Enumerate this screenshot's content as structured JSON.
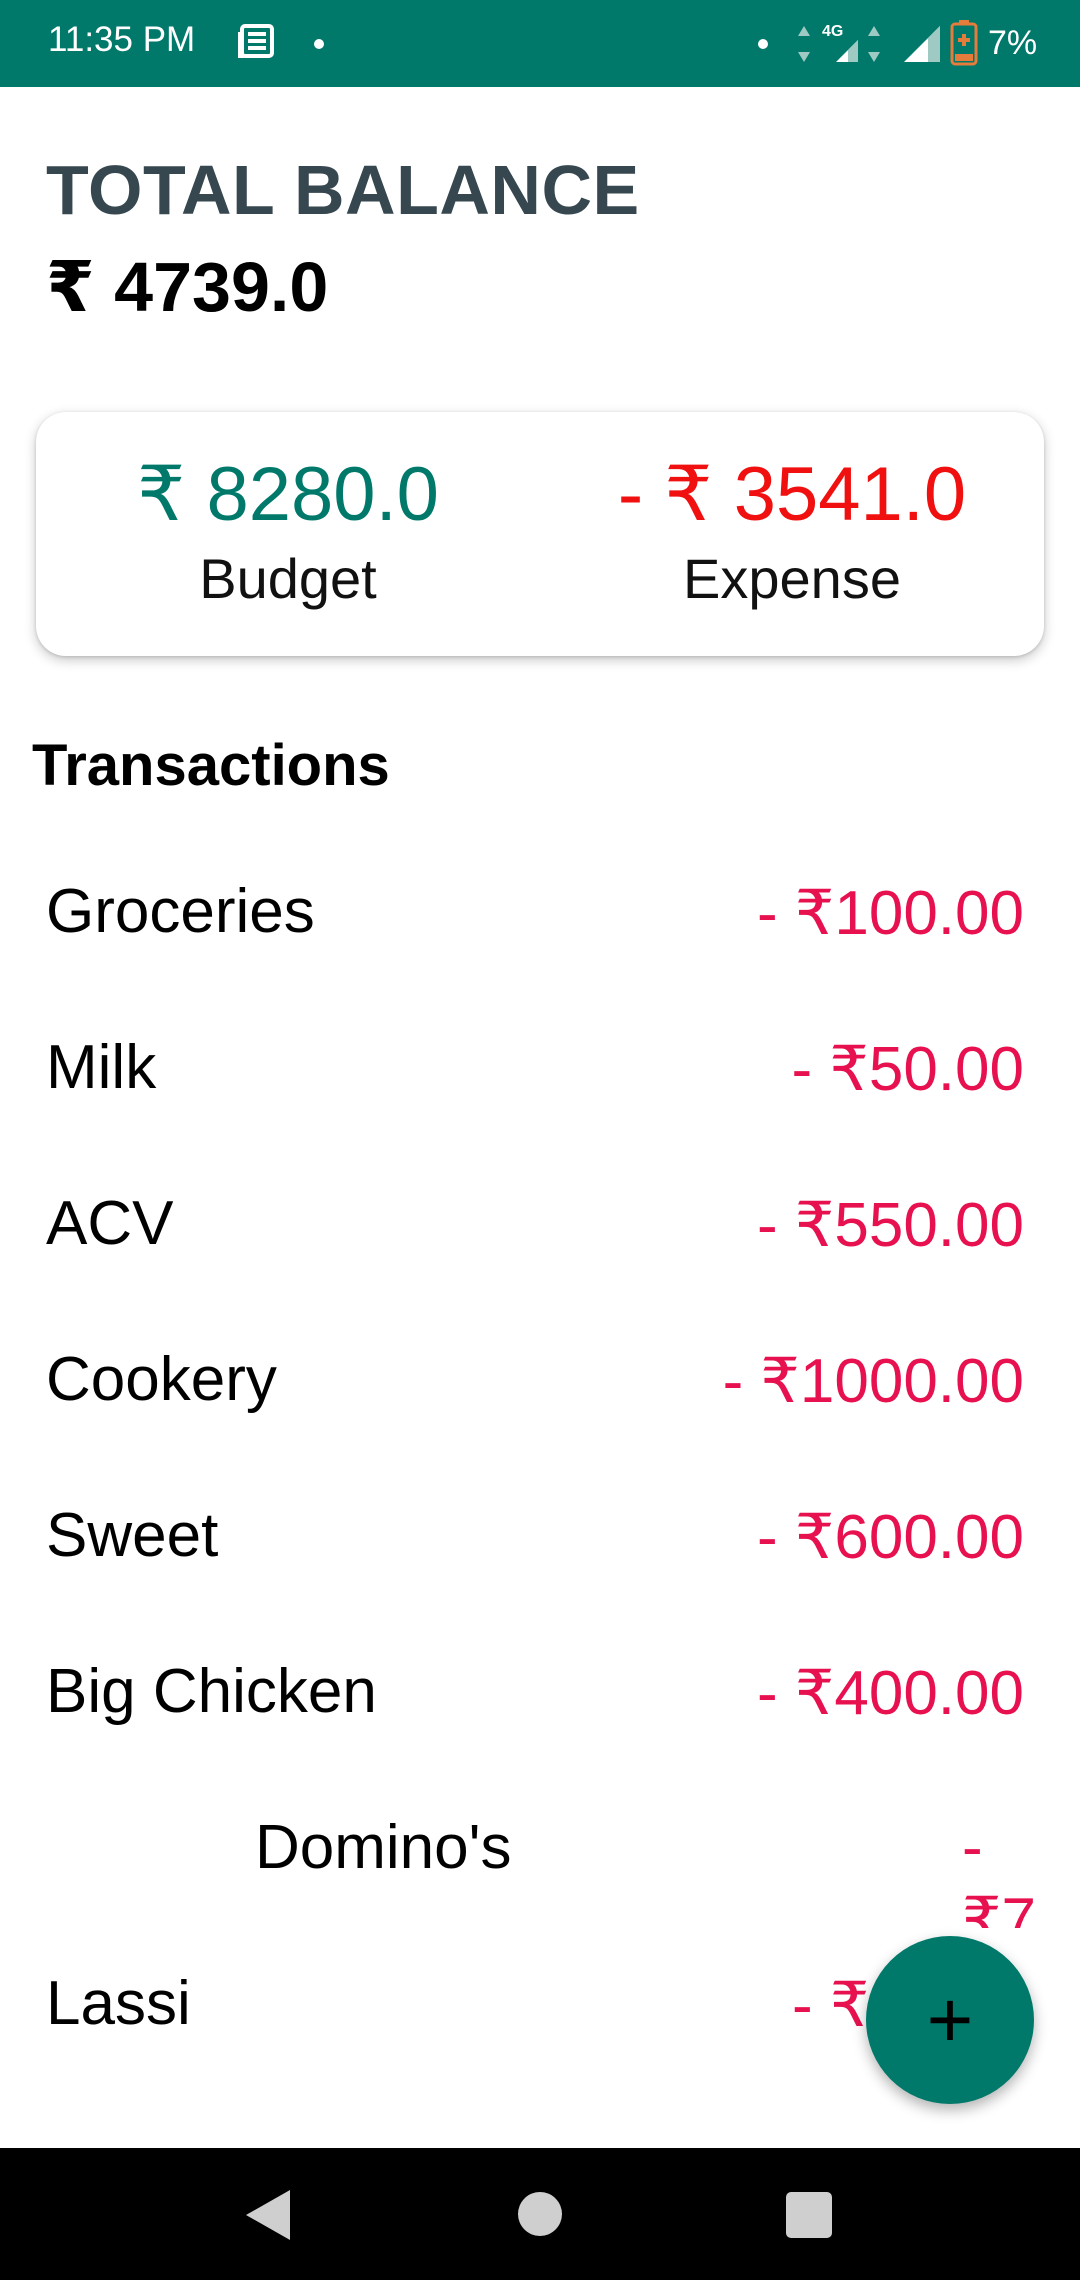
{
  "status_bar": {
    "time": "11:35 PM",
    "battery": "7%",
    "network": "4G",
    "icons": [
      "news-icon",
      "notification-dot-icon",
      "signal-4g-icon",
      "signal-icon",
      "battery-low-icon"
    ]
  },
  "header": {
    "title": "TOTAL BALANCE",
    "balance": "₹ 4739.0"
  },
  "summary": {
    "budget_amount": "₹ 8280.0",
    "budget_label": "Budget",
    "expense_amount": "- ₹ 3541.0",
    "expense_label": "Expense"
  },
  "transactions": {
    "heading": "Transactions",
    "items": [
      {
        "name": "Groceries",
        "amount": "- ₹100.00"
      },
      {
        "name": "Milk",
        "amount": "- ₹50.00"
      },
      {
        "name": "ACV",
        "amount": "- ₹550.00"
      },
      {
        "name": "Cookery",
        "amount": "- ₹1000.00"
      },
      {
        "name": "Sweet",
        "amount": "- ₹600.00"
      },
      {
        "name": "Big Chicken",
        "amount": "- ₹400.00"
      },
      {
        "name": "Domino's",
        "amount": "- ₹7"
      },
      {
        "name": "Lassi",
        "amount": "- ₹1"
      }
    ]
  },
  "fab": {
    "label": "+"
  },
  "colors": {
    "primary": "#00796b",
    "expense_red": "#f01010",
    "transaction_amount": "#e8114f",
    "title_gray": "#37474f"
  }
}
